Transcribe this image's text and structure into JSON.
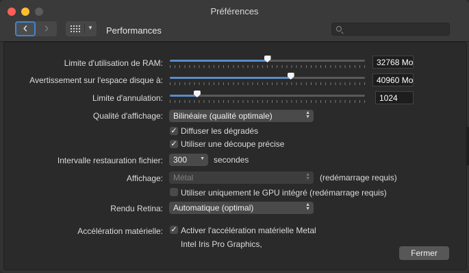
{
  "window": {
    "title": "Préférences"
  },
  "toolbar": {
    "back_icon": "chevron-left-icon",
    "forward_icon": "chevron-right-icon",
    "grid_icon": "grid-icon",
    "pane_title": "Performances",
    "search_placeholder": ""
  },
  "settings": {
    "ram_limit": {
      "label": "Limite d'utilisation de RAM:",
      "value": "32768 Mo",
      "fraction": 0.5
    },
    "disk_warning": {
      "label": "Avertissement sur l'espace disque à:",
      "value": "40960 Mo",
      "fraction": 0.62
    },
    "undo_limit": {
      "label": "Limite d'annulation:",
      "value": "1024",
      "fraction": 0.14
    },
    "display_quality": {
      "label": "Qualité d'affichage:",
      "value": "Bilinéaire (qualité optimale)"
    },
    "dither_gradients": {
      "label": "Diffuser les dégradés",
      "checked": true
    },
    "precise_clipping": {
      "label": "Utiliser une découpe précise",
      "checked": true
    },
    "file_recovery": {
      "label": "Intervalle restauration fichier:",
      "value": "300",
      "unit": "secondes"
    },
    "display": {
      "label": "Affichage:",
      "value": "Métal",
      "note": "(redémarrage requis)"
    },
    "integrated_gpu": {
      "label": "Utiliser uniquement le GPU intégré (redémarrage requis)",
      "checked": false
    },
    "retina": {
      "label": "Rendu Retina:",
      "value": "Automatique (optimal)"
    },
    "hw_accel": {
      "label": "Accélération matérielle:",
      "option": "Activer l'accélération matérielle Metal",
      "checked": true,
      "device": "Intel Iris Pro Graphics,"
    }
  },
  "footer": {
    "close_label": "Fermer"
  },
  "colors": {
    "accent": "#5b8cc6",
    "focus_ring": "#3d86d6",
    "close": "#fe5f57",
    "minimize": "#febc2e"
  }
}
